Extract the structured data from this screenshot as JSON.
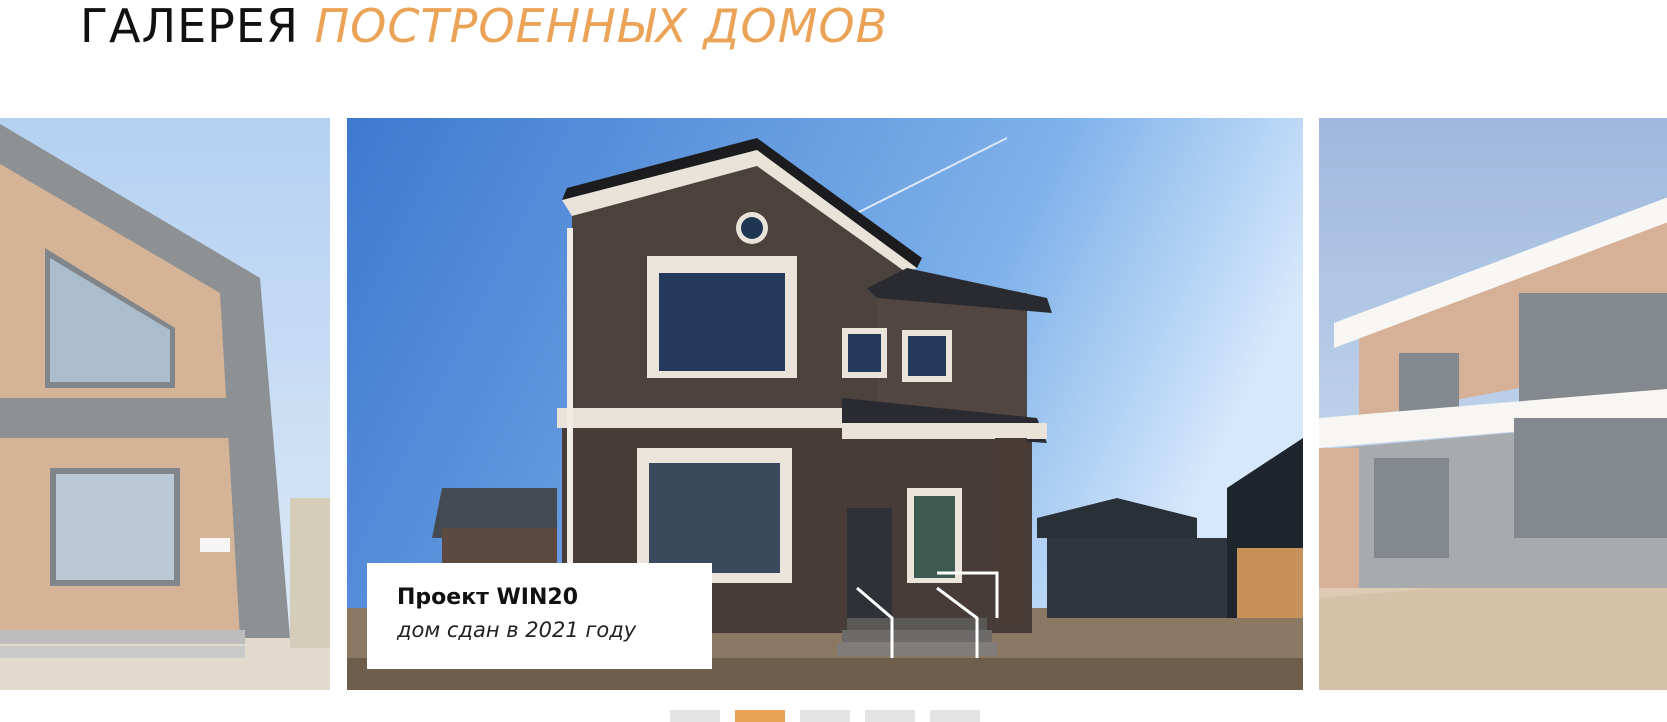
{
  "gallery": {
    "title_plain": "ГАЛЕРЕЯ",
    "title_accent": "ПОСТРОЕННЫХ ДОМОВ",
    "accent_color": "#eba457"
  },
  "slides": [
    {
      "position": "previous",
      "image": "house-wooden-gable-photo"
    },
    {
      "position": "current",
      "image": "house-brick-two-storey-photo",
      "caption_title": "Проект WIN20",
      "caption_subtitle": "дом сдан в 2021 году"
    },
    {
      "position": "next",
      "image": "house-modern-flat-roof-photo"
    }
  ],
  "pagination": {
    "count": 5,
    "active_index": 1
  }
}
